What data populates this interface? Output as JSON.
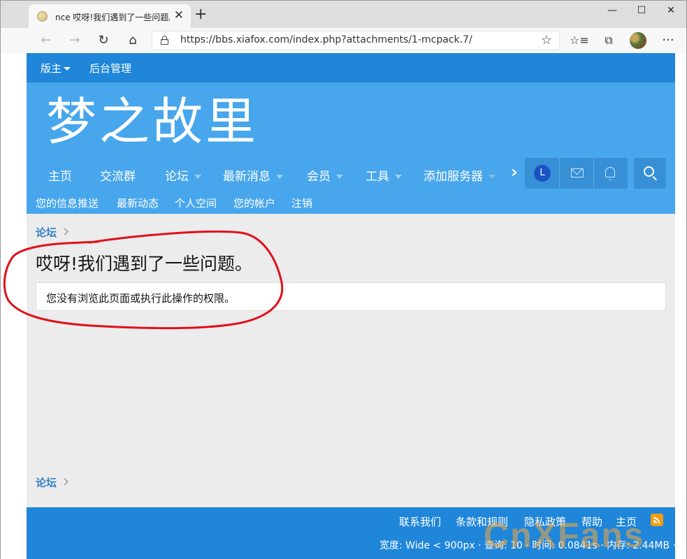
{
  "browser": {
    "tab_title": "nce 哎呀!我们遇到了一些问题。",
    "url": "https://bbs.xiafox.com/index.php?attachments/1-mcpack.7/",
    "window_controls": {
      "minimize": "—",
      "maximize": "☐",
      "close": "✕"
    }
  },
  "staffbar": {
    "items": [
      {
        "label": "版主"
      },
      {
        "label": "后台管理"
      }
    ]
  },
  "header": {
    "logo_text": "梦之故里"
  },
  "nav": {
    "items": [
      {
        "label": "主页",
        "has_menu": false
      },
      {
        "label": "交流群",
        "has_menu": false
      },
      {
        "label": "论坛",
        "has_menu": true
      },
      {
        "label": "最新消息",
        "has_menu": true
      },
      {
        "label": "会员",
        "has_menu": true
      },
      {
        "label": "工具",
        "has_menu": true
      },
      {
        "label": "添加服务器",
        "has_menu": true
      }
    ],
    "user_initial": "L"
  },
  "subnav": {
    "items": [
      {
        "label": "您的信息推送"
      },
      {
        "label": "最新动态"
      },
      {
        "label": "个人空间"
      },
      {
        "label": "您的帐户"
      },
      {
        "label": "注销"
      }
    ]
  },
  "breadcrumb": {
    "label": "论坛"
  },
  "main": {
    "title": "哎呀!我们遇到了一些问题。",
    "error_message": "您没有浏览此页面或执行此操作的权限。"
  },
  "footer": {
    "links": [
      {
        "label": "联系我们"
      },
      {
        "label": "条款和规则"
      },
      {
        "label": "隐私政策"
      },
      {
        "label": "帮助"
      },
      {
        "label": "主页"
      }
    ],
    "stats": "宽度: Wide < 900px · 查询: 10 · 时间: 0.0841s · 内存: 2.44MB ·"
  },
  "watermark": {
    "text": "CnXFans"
  },
  "colors": {
    "staffbar": "#1f86d9",
    "header": "#47a6ec",
    "annotation": "#e0101a"
  }
}
